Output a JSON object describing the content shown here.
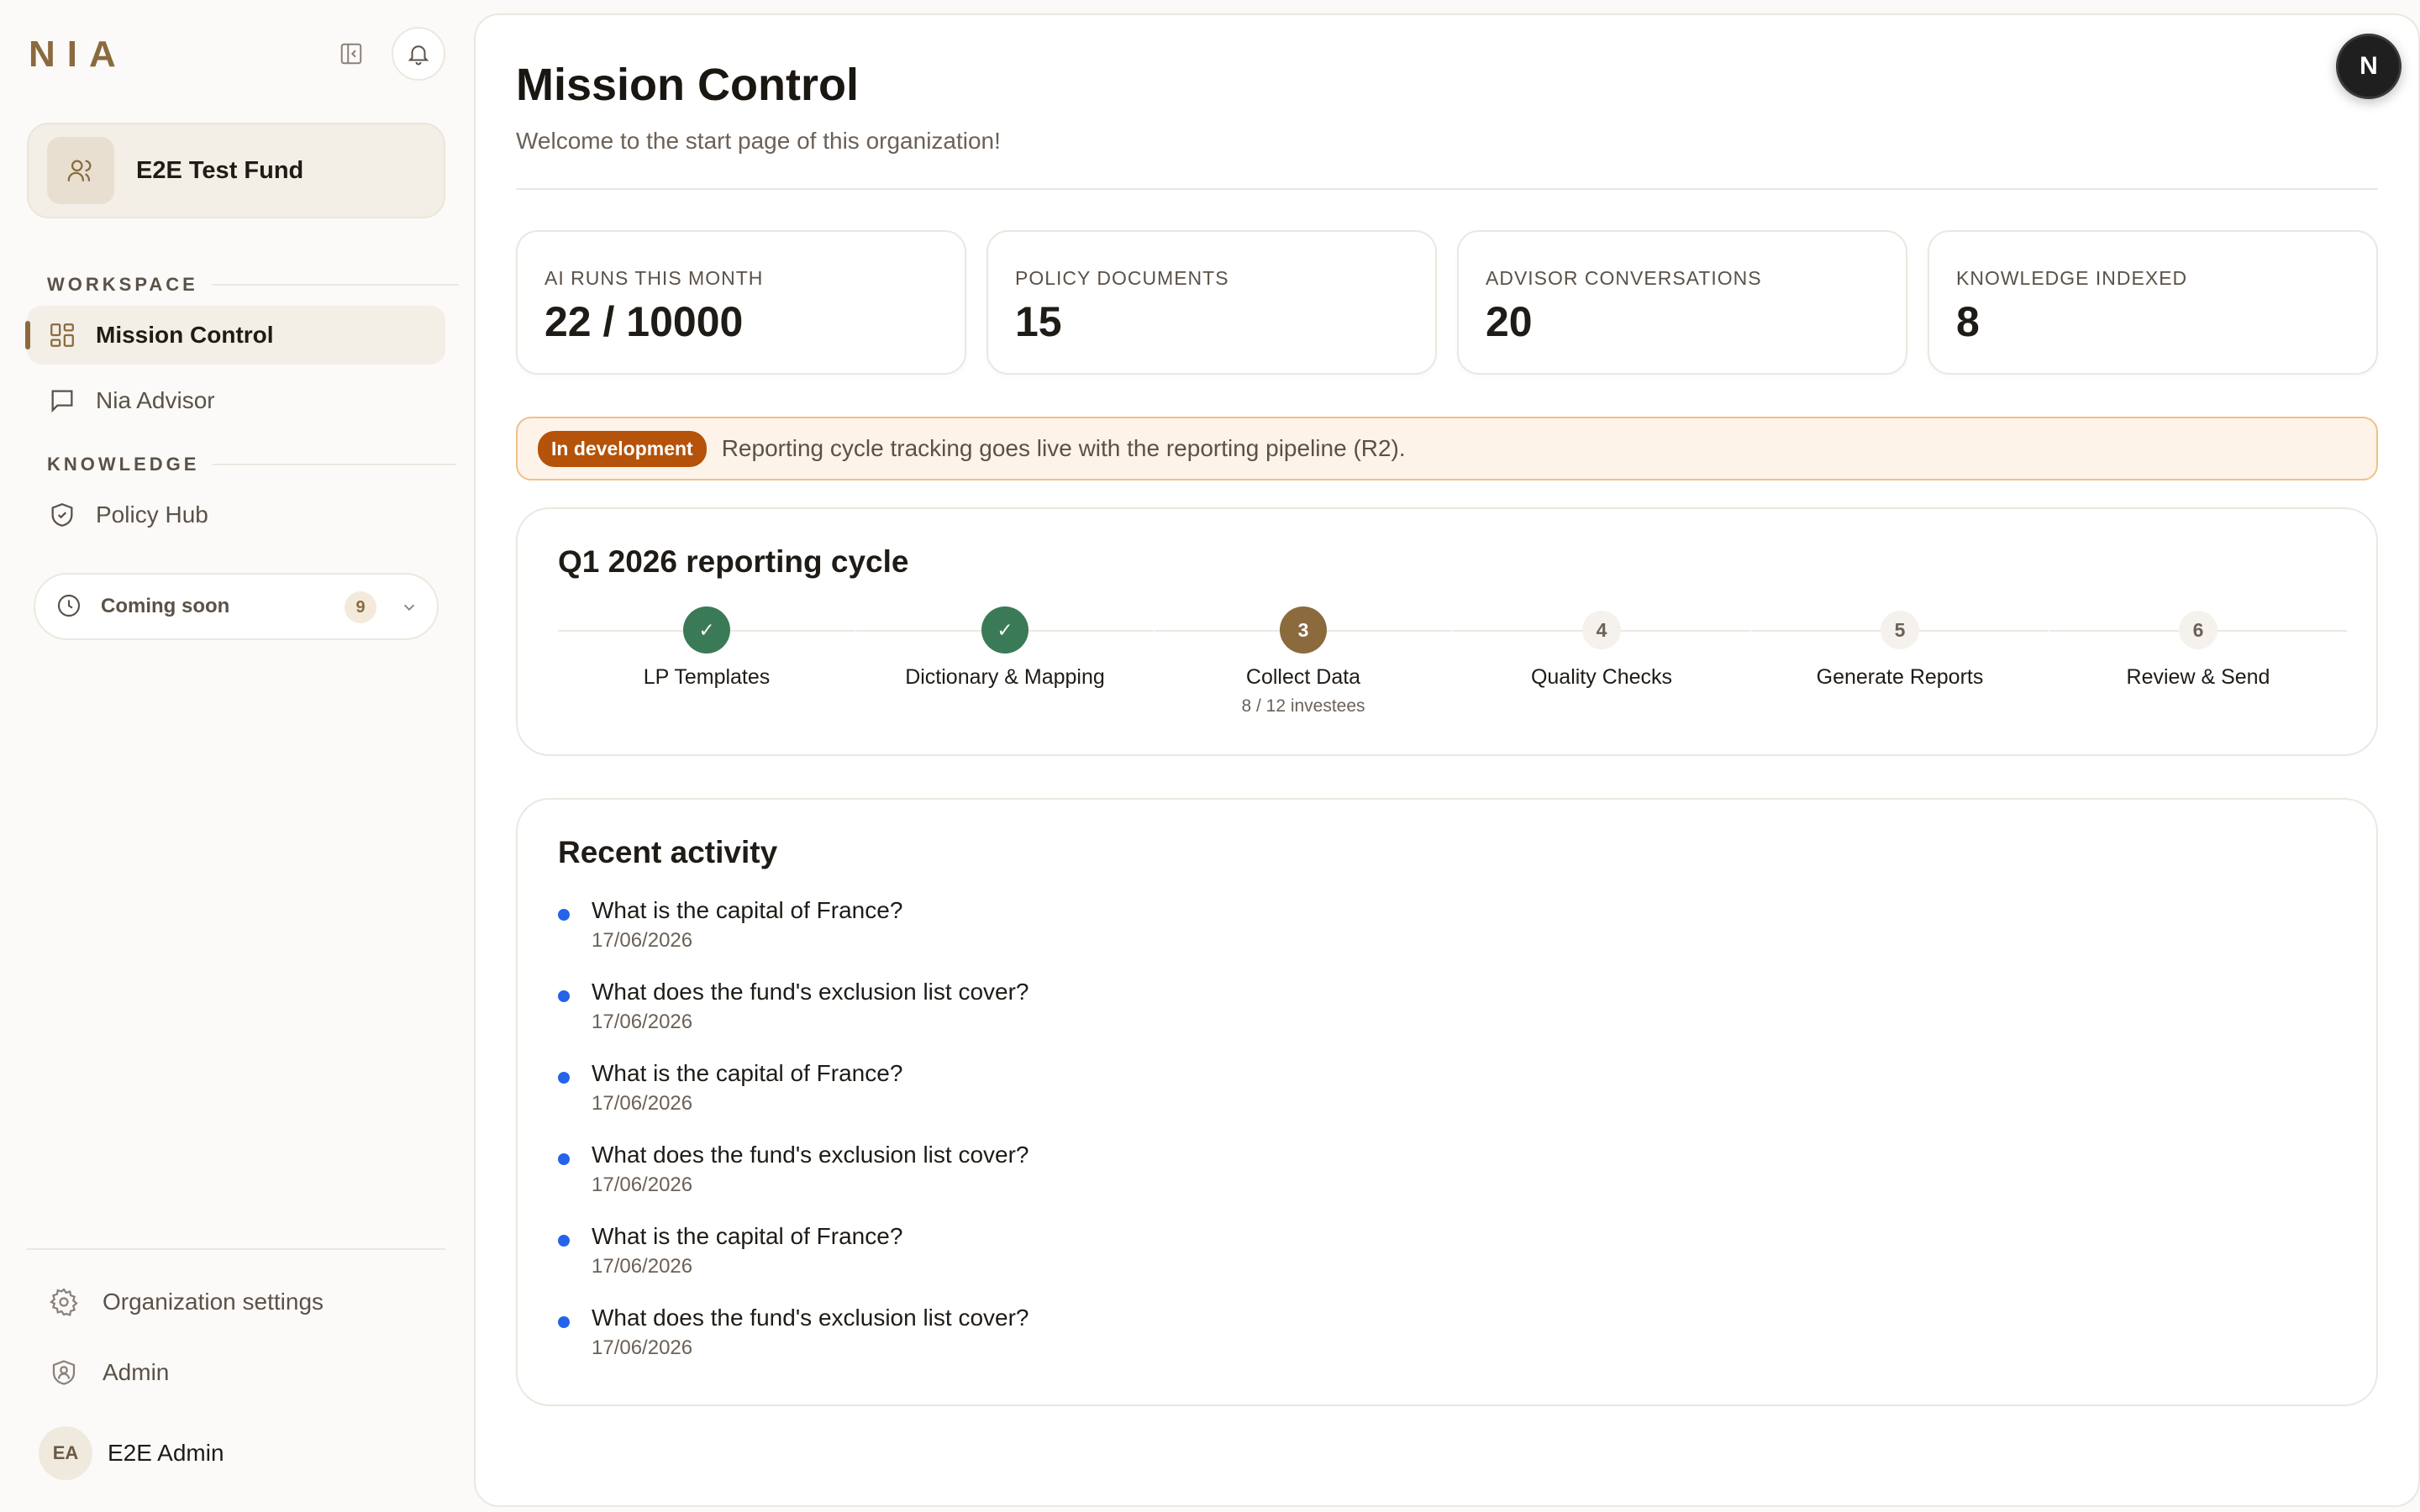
{
  "sidebar": {
    "logo": "NIA",
    "org_name": "E2E Test Fund",
    "sections": {
      "workspace": "WORKSPACE",
      "knowledge": "KNOWLEDGE"
    },
    "items": [
      {
        "label": "Mission Control",
        "active": true,
        "icon": "grid-icon"
      },
      {
        "label": "Nia Advisor",
        "active": false,
        "icon": "chat-icon"
      },
      {
        "label": "Policy Hub",
        "active": false,
        "icon": "shield-icon"
      }
    ],
    "coming_soon": {
      "label": "Coming soon",
      "count": "9"
    },
    "bottom": {
      "settings": "Organization settings",
      "admin": "Admin",
      "user_initials": "EA",
      "user_name": "E2E Admin"
    }
  },
  "header": {
    "title": "Mission Control",
    "subtitle": "Welcome to the start page of this organization!",
    "user_initial": "N"
  },
  "stats": [
    {
      "label": "AI RUNS THIS MONTH",
      "value": "22 / 10000"
    },
    {
      "label": "POLICY DOCUMENTS",
      "value": "15"
    },
    {
      "label": "ADVISOR CONVERSATIONS",
      "value": "20"
    },
    {
      "label": "KNOWLEDGE INDEXED",
      "value": "8"
    }
  ],
  "banner": {
    "pill": "In development",
    "text": "Reporting cycle tracking goes live with the reporting pipeline (R2)."
  },
  "cycle": {
    "title": "Q1 2026 reporting cycle",
    "steps": [
      {
        "marker": "✓",
        "label": "LP Templates",
        "status": "done",
        "sub": ""
      },
      {
        "marker": "✓",
        "label": "Dictionary & Mapping",
        "status": "done",
        "sub": ""
      },
      {
        "marker": "3",
        "label": "Collect Data",
        "status": "current",
        "sub": "8 / 12 investees"
      },
      {
        "marker": "4",
        "label": "Quality Checks",
        "status": "todo",
        "sub": ""
      },
      {
        "marker": "5",
        "label": "Generate Reports",
        "status": "todo",
        "sub": ""
      },
      {
        "marker": "6",
        "label": "Review & Send",
        "status": "todo",
        "sub": ""
      }
    ]
  },
  "activity": {
    "title": "Recent activity",
    "items": [
      {
        "question": "What is the capital of France?",
        "date": "17/06/2026"
      },
      {
        "question": "What does the fund's exclusion list cover?",
        "date": "17/06/2026"
      },
      {
        "question": "What is the capital of France?",
        "date": "17/06/2026"
      },
      {
        "question": "What does the fund's exclusion list cover?",
        "date": "17/06/2026"
      },
      {
        "question": "What is the capital of France?",
        "date": "17/06/2026"
      },
      {
        "question": "What does the fund's exclusion list cover?",
        "date": "17/06/2026"
      }
    ]
  },
  "colors": {
    "accent": "#8b6a3e",
    "done": "#3b7a57",
    "dev": "#b45309",
    "dot": "#2563eb"
  }
}
